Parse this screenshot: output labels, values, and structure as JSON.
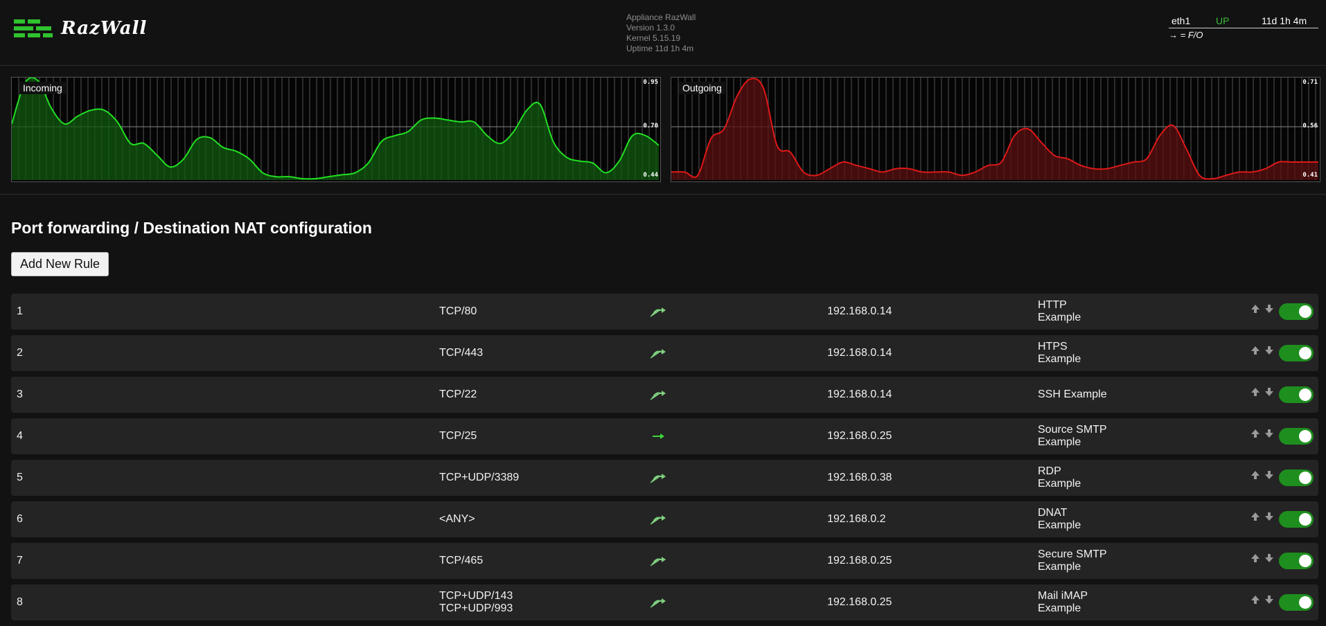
{
  "app": {
    "name": "RazWall",
    "info_lines": [
      "Appliance RazWall",
      "Version 1.3.0",
      "Kernel 5.15.19",
      "Uptime 11d 1h 4m"
    ]
  },
  "interface": {
    "name": "eth1",
    "status": "UP",
    "uptime": "11d 1h 4m",
    "fo_label": "→ = F/O",
    "status_color": "#3bbd3b"
  },
  "charts": [
    {
      "label": "Incoming",
      "ticks": [
        "0.95",
        "0.70",
        "0.44"
      ],
      "ylim": [
        0.44,
        0.95
      ],
      "color": "#22e022",
      "fill": "#0f5a0f",
      "values": [
        0.72,
        0.93,
        0.94,
        0.8,
        0.72,
        0.76,
        0.79,
        0.79,
        0.73,
        0.62,
        0.62,
        0.56,
        0.5,
        0.54,
        0.64,
        0.65,
        0.6,
        0.58,
        0.54,
        0.47,
        0.45,
        0.45,
        0.44,
        0.44,
        0.45,
        0.46,
        0.47,
        0.52,
        0.63,
        0.66,
        0.68,
        0.74,
        0.75,
        0.74,
        0.73,
        0.73,
        0.66,
        0.62,
        0.68,
        0.79,
        0.82,
        0.63,
        0.55,
        0.53,
        0.52,
        0.47,
        0.53,
        0.66,
        0.66,
        0.61
      ]
    },
    {
      "label": "Outgoing",
      "ticks": [
        "0.71",
        "0.56",
        "0.41"
      ],
      "ylim": [
        0.41,
        0.71
      ],
      "color": "#e01818",
      "fill": "#5a0f0f",
      "values": [
        0.43,
        0.43,
        0.42,
        0.53,
        0.56,
        0.66,
        0.71,
        0.68,
        0.51,
        0.49,
        0.43,
        0.42,
        0.44,
        0.46,
        0.45,
        0.44,
        0.43,
        0.44,
        0.44,
        0.43,
        0.43,
        0.43,
        0.42,
        0.43,
        0.45,
        0.46,
        0.54,
        0.56,
        0.52,
        0.48,
        0.47,
        0.45,
        0.44,
        0.44,
        0.45,
        0.46,
        0.47,
        0.54,
        0.57,
        0.5,
        0.42,
        0.41,
        0.42,
        0.43,
        0.43,
        0.44,
        0.46,
        0.46,
        0.46,
        0.46
      ]
    }
  ],
  "page": {
    "title": "Port forwarding / Destination NAT configuration",
    "add_button": "Add New Rule"
  },
  "rules": [
    {
      "num": "1",
      "ports": [
        "TCP/80"
      ],
      "icon": "forward-fo",
      "ip": "192.168.0.14",
      "desc": [
        "HTTP",
        "Example"
      ],
      "enabled": true
    },
    {
      "num": "2",
      "ports": [
        "TCP/443"
      ],
      "icon": "forward-fo",
      "ip": "192.168.0.14",
      "desc": [
        "HTPS",
        "Example"
      ],
      "enabled": true
    },
    {
      "num": "3",
      "ports": [
        "TCP/22"
      ],
      "icon": "forward-fo",
      "ip": "192.168.0.14",
      "desc": [
        "SSH Example"
      ],
      "enabled": true
    },
    {
      "num": "4",
      "ports": [
        "TCP/25"
      ],
      "icon": "forward",
      "ip": "192.168.0.25",
      "desc": [
        "Source SMTP",
        "Example"
      ],
      "enabled": true
    },
    {
      "num": "5",
      "ports": [
        "TCP+UDP/3389"
      ],
      "icon": "forward-fo",
      "ip": "192.168.0.38",
      "desc": [
        "RDP",
        "Example"
      ],
      "enabled": true
    },
    {
      "num": "6",
      "ports": [
        "<ANY>"
      ],
      "icon": "forward-fo",
      "ip": "192.168.0.2",
      "desc": [
        "DNAT",
        "Example"
      ],
      "enabled": true
    },
    {
      "num": "7",
      "ports": [
        "TCP/465"
      ],
      "icon": "forward-fo",
      "ip": "192.168.0.25",
      "desc": [
        "Secure SMTP",
        "Example"
      ],
      "enabled": true
    },
    {
      "num": "8",
      "ports": [
        "TCP+UDP/143",
        "TCP+UDP/993"
      ],
      "icon": "forward-fo",
      "ip": "192.168.0.25",
      "desc": [
        "Mail iMAP",
        "Example"
      ],
      "enabled": true
    }
  ]
}
